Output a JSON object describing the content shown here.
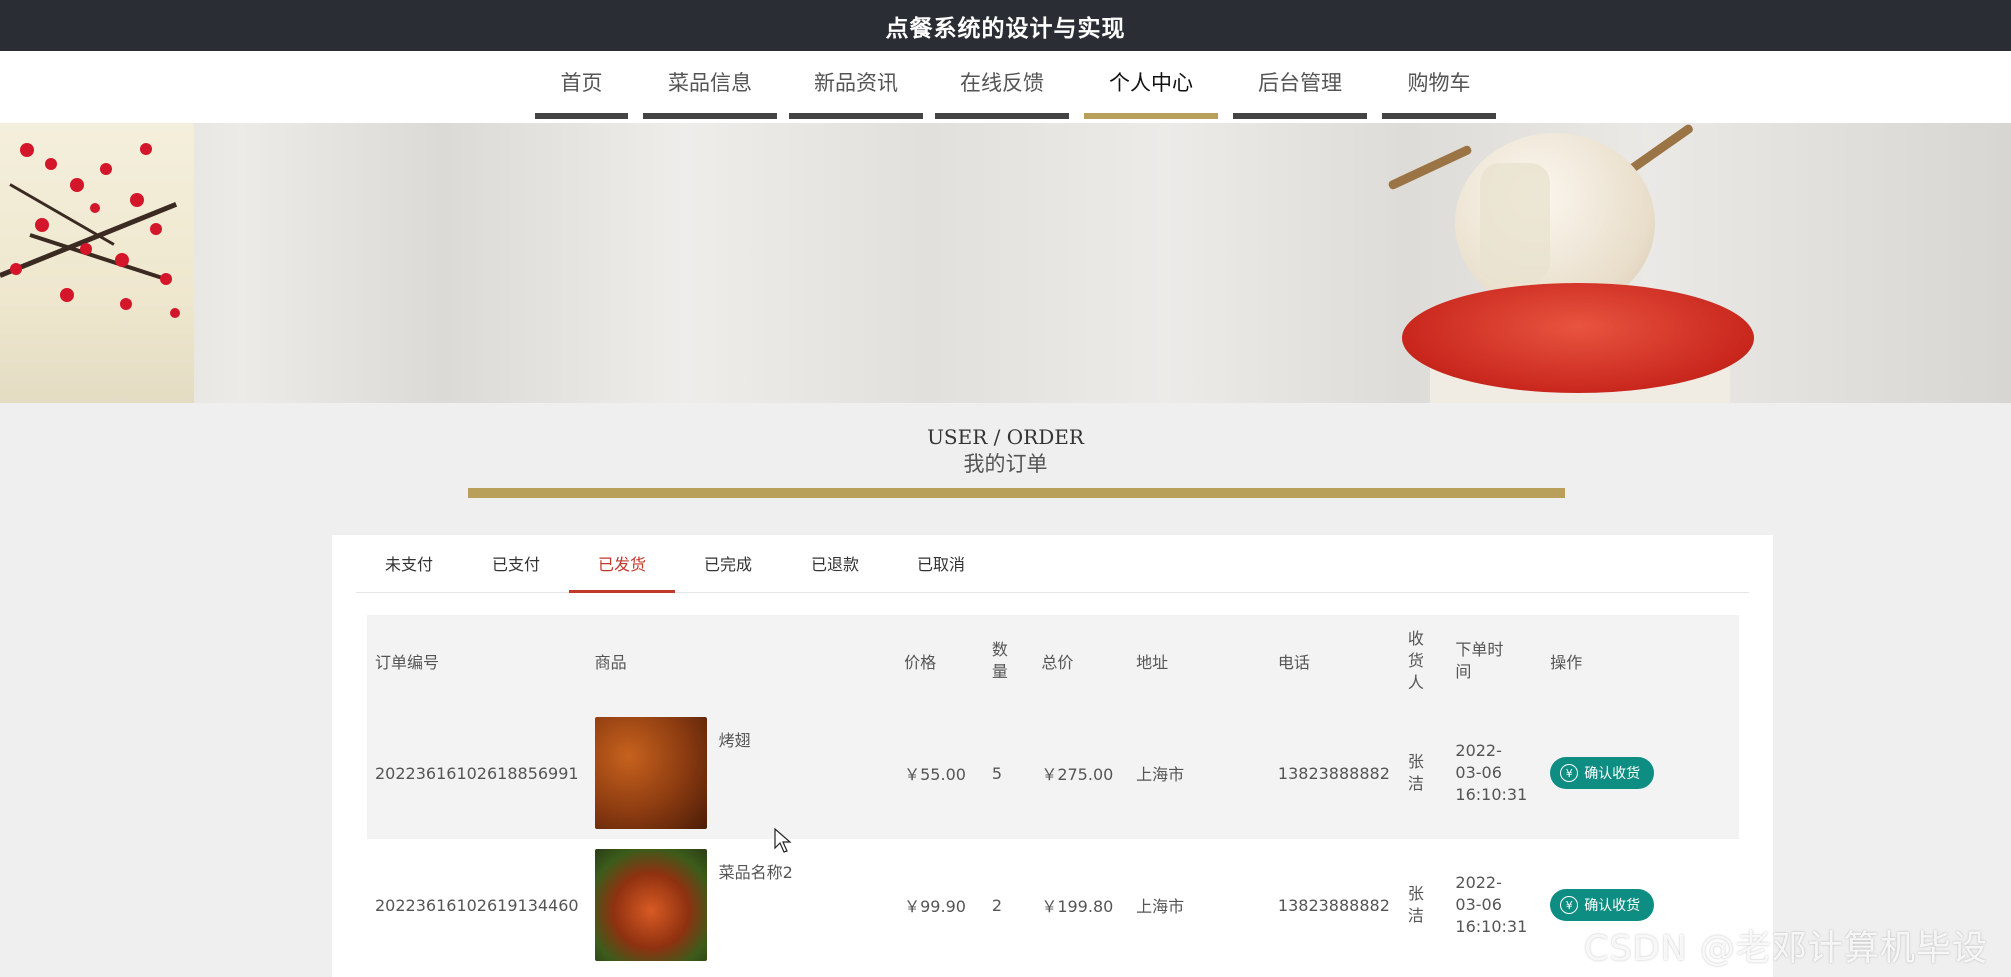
{
  "app": {
    "title": "点餐系统的设计与实现"
  },
  "nav": {
    "items": [
      {
        "label": "首页"
      },
      {
        "label": "菜品信息"
      },
      {
        "label": "新品资讯"
      },
      {
        "label": "在线反馈"
      },
      {
        "label": "个人中心",
        "active": true
      },
      {
        "label": "后台管理"
      },
      {
        "label": "购物车"
      }
    ]
  },
  "section": {
    "title_en": "USER / ORDER",
    "title_cn": "我的订单"
  },
  "tabs": [
    {
      "label": "未支付"
    },
    {
      "label": "已支付"
    },
    {
      "label": "已发货",
      "active": true
    },
    {
      "label": "已完成"
    },
    {
      "label": "已退款"
    },
    {
      "label": "已取消"
    }
  ],
  "table": {
    "headers": {
      "order_no": "订单编号",
      "product": "商品",
      "price": "价格",
      "qty_1": "数",
      "qty_2": "量",
      "total": "总价",
      "address": "地址",
      "phone": "电话",
      "receiver_1": "收",
      "receiver_2": "货",
      "receiver_3": "人",
      "time_1": "下单时",
      "time_2": "间",
      "action": "操作"
    },
    "rows": [
      {
        "order_no": "20223616102618856991",
        "product": "烤翅",
        "product_icon": "wings-photo",
        "price": "￥55.00",
        "qty": "5",
        "total": "￥275.00",
        "address": "上海市",
        "phone": "13823888882",
        "receiver_1": "张",
        "receiver_2": "洁",
        "date_1": "2022-",
        "date_2": "03-06",
        "date_3": "16:10:31",
        "action": "确认收货"
      },
      {
        "order_no": "20223616102619134460",
        "product": "菜品名称2",
        "product_icon": "shrimp-photo",
        "price": "￥99.90",
        "qty": "2",
        "total": "￥199.80",
        "address": "上海市",
        "phone": "13823888882",
        "receiver_1": "张",
        "receiver_2": "洁",
        "date_1": "2022-",
        "date_2": "03-06",
        "date_3": "16:10:31",
        "action": "确认收货"
      }
    ]
  },
  "watermark": "CSDN @老邓计算机毕设",
  "colors": {
    "accent": "#b8a05a",
    "topbar": "#2a2d33",
    "button": "#0e8e82",
    "tab_active": "#c0392b"
  }
}
